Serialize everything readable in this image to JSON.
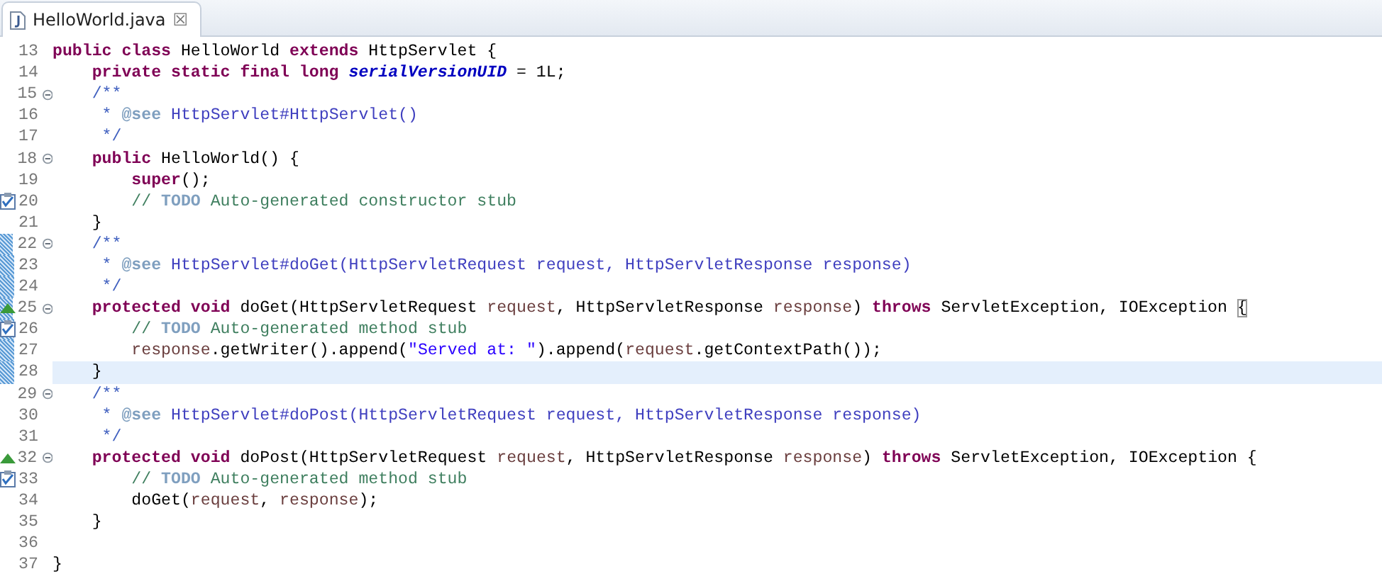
{
  "tabs": [
    {
      "label": "HelloWorld.java",
      "selected": true,
      "close": "☒"
    }
  ],
  "lines": [
    {
      "number": "13",
      "fold": false,
      "in_range": false,
      "highlighted": false,
      "tokens": [
        {
          "kind": "keyword",
          "text": "public class "
        },
        {
          "kind": "plain",
          "text": "HelloWorld "
        },
        {
          "kind": "keyword",
          "text": "extends "
        },
        {
          "kind": "plain",
          "text": "HttpServlet {"
        }
      ]
    },
    {
      "number": "14",
      "fold": false,
      "in_range": false,
      "highlighted": false,
      "tokens": [
        {
          "kind": "keyword",
          "text": "    private static final long "
        },
        {
          "kind": "field",
          "text": "serialVersionUID"
        },
        {
          "kind": "plain",
          "text": " = 1L;"
        }
      ]
    },
    {
      "number": "15",
      "fold": true,
      "in_range": false,
      "highlighted": false,
      "tokens": [
        {
          "kind": "javadoc",
          "text": "    /**"
        }
      ]
    },
    {
      "number": "16",
      "fold": false,
      "in_range": false,
      "highlighted": false,
      "tokens": [
        {
          "kind": "javadoc",
          "text": "     * "
        },
        {
          "kind": "javadoc_tag",
          "text": "@see"
        },
        {
          "kind": "javadoc_link",
          "text": " HttpServlet#HttpServlet()"
        }
      ]
    },
    {
      "number": "17",
      "fold": false,
      "in_range": false,
      "highlighted": false,
      "tokens": [
        {
          "kind": "javadoc",
          "text": "     */"
        }
      ]
    },
    {
      "number": "18",
      "fold": true,
      "in_range": false,
      "highlighted": false,
      "tokens": [
        {
          "kind": "keyword",
          "text": "    public "
        },
        {
          "kind": "plain",
          "text": "HelloWorld() {"
        }
      ]
    },
    {
      "number": "19",
      "fold": false,
      "in_range": false,
      "highlighted": false,
      "tokens": [
        {
          "kind": "keyword",
          "text": "        super"
        },
        {
          "kind": "plain",
          "text": "();"
        }
      ]
    },
    {
      "number": "20",
      "fold": false,
      "override_marker": false,
      "task_marker": true,
      "in_range": false,
      "highlighted": false,
      "tokens": [
        {
          "kind": "comment",
          "text": "        // "
        },
        {
          "kind": "todo",
          "text": "TODO"
        },
        {
          "kind": "comment",
          "text": " Auto-generated constructor stub"
        }
      ]
    },
    {
      "number": "21",
      "fold": false,
      "in_range": false,
      "highlighted": false,
      "tokens": [
        {
          "kind": "plain",
          "text": "    }"
        }
      ]
    },
    {
      "number": "22",
      "fold": true,
      "in_range": true,
      "highlighted": false,
      "tokens": [
        {
          "kind": "javadoc",
          "text": "    /**"
        }
      ]
    },
    {
      "number": "23",
      "fold": false,
      "in_range": true,
      "highlighted": false,
      "tokens": [
        {
          "kind": "javadoc",
          "text": "     * "
        },
        {
          "kind": "javadoc_tag",
          "text": "@see"
        },
        {
          "kind": "javadoc_link",
          "text": " HttpServlet#doGet(HttpServletRequest request, HttpServletResponse response)"
        }
      ]
    },
    {
      "number": "24",
      "fold": false,
      "in_range": true,
      "highlighted": false,
      "tokens": [
        {
          "kind": "javadoc",
          "text": "     */"
        }
      ]
    },
    {
      "number": "25",
      "fold": true,
      "override_marker": true,
      "task_marker": false,
      "in_range": true,
      "highlighted": false,
      "tokens": [
        {
          "kind": "keyword",
          "text": "    protected void "
        },
        {
          "kind": "plain",
          "text": "doGet(HttpServletRequest "
        },
        {
          "kind": "param",
          "text": "request"
        },
        {
          "kind": "plain",
          "text": ", HttpServletResponse "
        },
        {
          "kind": "param",
          "text": "response"
        },
        {
          "kind": "plain",
          "text": ") "
        },
        {
          "kind": "keyword",
          "text": "throws "
        },
        {
          "kind": "plain",
          "text": "ServletException, IOException "
        },
        {
          "kind": "bracket_match",
          "text": "{"
        }
      ]
    },
    {
      "number": "26",
      "fold": false,
      "override_marker": false,
      "task_marker": true,
      "in_range": true,
      "highlighted": false,
      "tokens": [
        {
          "kind": "comment",
          "text": "        // "
        },
        {
          "kind": "todo",
          "text": "TODO"
        },
        {
          "kind": "comment",
          "text": " Auto-generated method stub"
        }
      ]
    },
    {
      "number": "27",
      "fold": false,
      "in_range": true,
      "highlighted": false,
      "tokens": [
        {
          "kind": "param",
          "text": "        response"
        },
        {
          "kind": "plain",
          "text": ".getWriter().append("
        },
        {
          "kind": "string",
          "text": "\"Served at: \""
        },
        {
          "kind": "plain",
          "text": ").append("
        },
        {
          "kind": "param",
          "text": "request"
        },
        {
          "kind": "plain",
          "text": ".getContextPath());"
        }
      ]
    },
    {
      "number": "28",
      "fold": false,
      "in_range": true,
      "highlighted": true,
      "tokens": [
        {
          "kind": "plain",
          "text": "    }"
        }
      ]
    },
    {
      "number": "29",
      "fold": true,
      "in_range": false,
      "highlighted": false,
      "tokens": [
        {
          "kind": "javadoc",
          "text": "    /**"
        }
      ]
    },
    {
      "number": "30",
      "fold": false,
      "in_range": false,
      "highlighted": false,
      "tokens": [
        {
          "kind": "javadoc",
          "text": "     * "
        },
        {
          "kind": "javadoc_tag",
          "text": "@see"
        },
        {
          "kind": "javadoc_link",
          "text": " HttpServlet#doPost(HttpServletRequest request, HttpServletResponse response)"
        }
      ]
    },
    {
      "number": "31",
      "fold": false,
      "in_range": false,
      "highlighted": false,
      "tokens": [
        {
          "kind": "javadoc",
          "text": "     */"
        }
      ]
    },
    {
      "number": "32",
      "fold": true,
      "override_marker": true,
      "task_marker": false,
      "in_range": false,
      "highlighted": false,
      "tokens": [
        {
          "kind": "keyword",
          "text": "    protected void "
        },
        {
          "kind": "plain",
          "text": "doPost(HttpServletRequest "
        },
        {
          "kind": "param",
          "text": "request"
        },
        {
          "kind": "plain",
          "text": ", HttpServletResponse "
        },
        {
          "kind": "param",
          "text": "response"
        },
        {
          "kind": "plain",
          "text": ") "
        },
        {
          "kind": "keyword",
          "text": "throws "
        },
        {
          "kind": "plain",
          "text": "ServletException, IOException {"
        }
      ]
    },
    {
      "number": "33",
      "fold": false,
      "override_marker": false,
      "task_marker": true,
      "in_range": false,
      "highlighted": false,
      "tokens": [
        {
          "kind": "comment",
          "text": "        // "
        },
        {
          "kind": "todo",
          "text": "TODO"
        },
        {
          "kind": "comment",
          "text": " Auto-generated method stub"
        }
      ]
    },
    {
      "number": "34",
      "fold": false,
      "in_range": false,
      "highlighted": false,
      "tokens": [
        {
          "kind": "plain",
          "text": "        doGet("
        },
        {
          "kind": "param",
          "text": "request"
        },
        {
          "kind": "plain",
          "text": ", "
        },
        {
          "kind": "param",
          "text": "response"
        },
        {
          "kind": "plain",
          "text": ");"
        }
      ]
    },
    {
      "number": "35",
      "fold": false,
      "in_range": false,
      "highlighted": false,
      "tokens": [
        {
          "kind": "plain",
          "text": "    }"
        }
      ]
    },
    {
      "number": "36",
      "fold": false,
      "in_range": false,
      "highlighted": false
    },
    {
      "number": "37",
      "fold": false,
      "in_range": false,
      "highlighted": false,
      "tokens": [
        {
          "kind": "plain",
          "text": "}"
        }
      ]
    }
  ]
}
